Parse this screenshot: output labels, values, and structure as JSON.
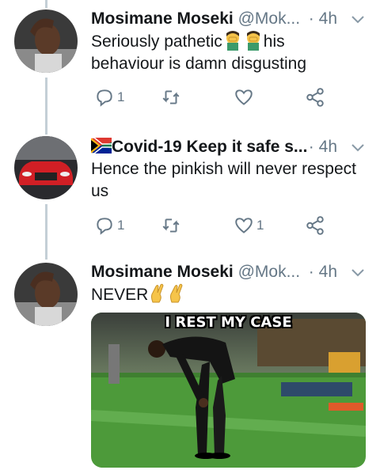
{
  "tweets": [
    {
      "name": "Mosimane Moseki",
      "handle": "@Mok...",
      "separator": "·",
      "time": "4h",
      "text_before": "Seriously pathetic",
      "text_after": "his",
      "text_line2": "behaviour is damn disgusting",
      "emoji": [
        "facepalm-man",
        "facepalm-man"
      ],
      "reply_count": "1",
      "retweet_count": "",
      "like_count": ""
    },
    {
      "name": "Covid-19 Keep it safe s...",
      "flag": "south-africa-flag",
      "separator": "·",
      "time": "4h",
      "text_line1": "Hence the pinkish will never respect",
      "text_line2": "us",
      "reply_count": "1",
      "retweet_count": "",
      "like_count": "1"
    },
    {
      "name": "Mosimane Moseki",
      "handle": "@Mok...",
      "separator": "·",
      "time": "4h",
      "text": "NEVER",
      "emoji": [
        "crossed-fingers",
        "crossed-fingers"
      ],
      "meme_caption": "I REST MY CASE"
    }
  ],
  "colors": {
    "secondary_text": "#657786",
    "thread_line": "#c4cfd6",
    "pitch_green": "#4d9a3a"
  }
}
